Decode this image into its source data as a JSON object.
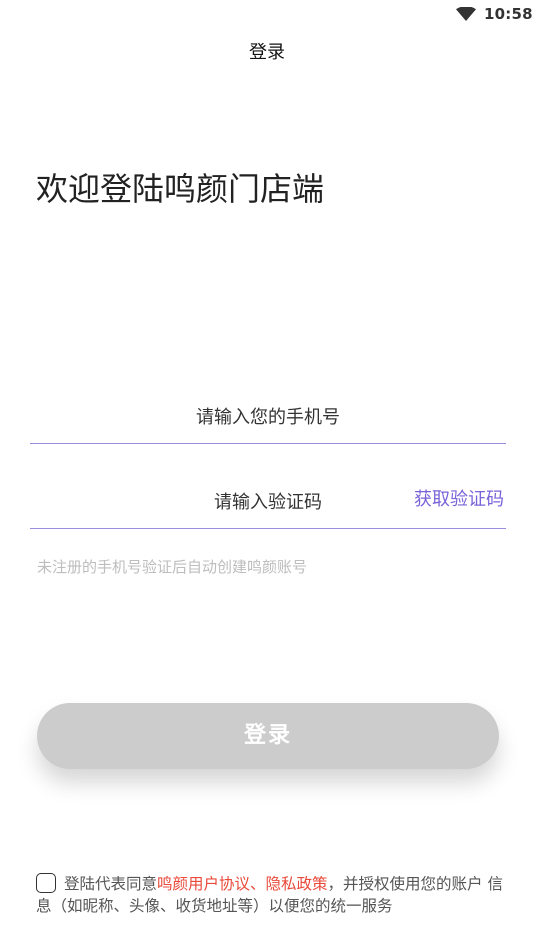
{
  "status_bar": {
    "time": "10:58",
    "wifi_icon": "wifi-icon"
  },
  "header": {
    "title": "登录"
  },
  "welcome": {
    "text": "欢迎登陆鸣颜门店端"
  },
  "form": {
    "phone_placeholder": "请输入您的手机号",
    "code_placeholder": "请输入验证码",
    "get_code_label": "获取验证码",
    "hint": "未注册的手机号验证后自动创建鸣颜账号",
    "underline_color": "#9a8ee0",
    "accent_color": "#7a63d8"
  },
  "login_button": {
    "label": "登录",
    "color": "#cccccc"
  },
  "agreement": {
    "checked": false,
    "prefix": "登陆代表同意",
    "links": "鸣颜用户协议、隐私政策",
    "suffix": "，并授权使用您的账户 信息（如昵称、头像、收货地址等）以便您的统一服务",
    "link_color": "#e94a3a"
  }
}
